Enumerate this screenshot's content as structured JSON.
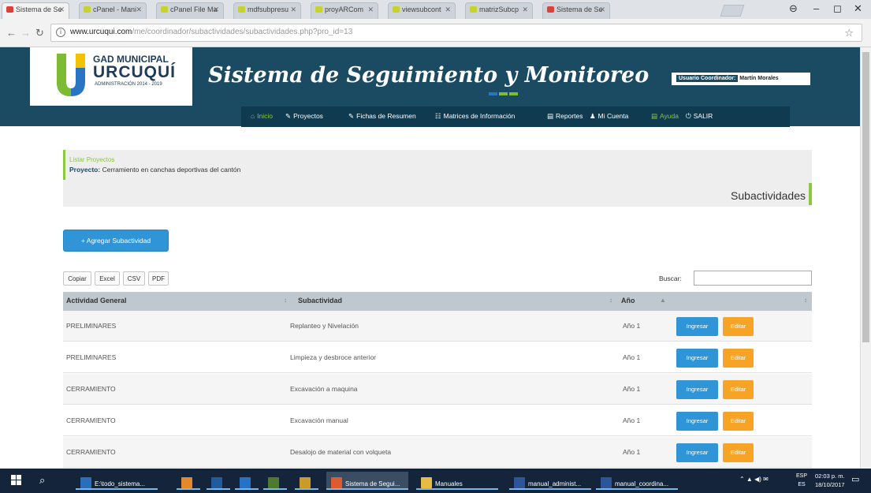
{
  "browser": {
    "tabs": [
      {
        "label": "Sistema de Se",
        "favicon": "red"
      },
      {
        "label": "cPanel - Mani",
        "favicon": "lime"
      },
      {
        "label": "cPanel File Ma",
        "favicon": "lime"
      },
      {
        "label": "mdfsubpresu",
        "favicon": "lime"
      },
      {
        "label": "proyARCom",
        "favicon": "lime"
      },
      {
        "label": "viewsubcont",
        "favicon": "lime"
      },
      {
        "label": "matrizSubcp",
        "favicon": "lime"
      },
      {
        "label": "Sistema de Se",
        "favicon": "red"
      }
    ],
    "url_host": "www.urcuqui.com",
    "url_path": "/me/coordinador/subactividades/subactividades.php?pro_id=13"
  },
  "header": {
    "logo_line1": "GAD MUNICIPAL",
    "logo_line2": "URCUQUÍ",
    "logo_line3": "ADMINISTRACIÓN 2014 - 2019",
    "site_title": "Sistema de Seguimiento y Monitoreo",
    "user_role": "Usuario Coordinador:",
    "user_name": "Martín Morales"
  },
  "menu": [
    {
      "label": "Inicio",
      "icon": "home-icon",
      "glyph": "⌂"
    },
    {
      "label": "Proyectos",
      "icon": "pencil-icon",
      "glyph": "✎"
    },
    {
      "label": "Fichas de Resumen",
      "icon": "pencil-icon",
      "glyph": "✎"
    },
    {
      "label": "Matrices de Información",
      "icon": "grid-icon",
      "glyph": "☷"
    },
    {
      "label": "Reportes",
      "icon": "document-icon",
      "glyph": "▤"
    },
    {
      "label": "Mi Cuenta",
      "icon": "user-icon",
      "glyph": "♟"
    },
    {
      "label": "Ayuda",
      "icon": "document-icon",
      "glyph": "▤"
    },
    {
      "label": "SALIR",
      "icon": "power-icon",
      "glyph": "⏻"
    }
  ],
  "breadcrumb": {
    "link": "Listar Proyectos",
    "project_label": "Proyecto:",
    "project_name": "Cerramiento en canchas deportivas del cantón"
  },
  "page_title": "Subactividades",
  "add_button": "+ Agregar Subactividad",
  "export_buttons": [
    "Copiar",
    "Excel",
    "CSV",
    "PDF"
  ],
  "search_label": "Buscar:",
  "table": {
    "headers": [
      "Actividad General",
      "Subactividad",
      "Año"
    ],
    "rows": [
      {
        "actividad": "PRELIMINARES",
        "subactividad": "Replanteo y Nivelación",
        "anio": "Año 1"
      },
      {
        "actividad": "PRELIMINARES",
        "subactividad": "Limpieza y desbroce anterior",
        "anio": "Año 1"
      },
      {
        "actividad": "CERRAMIENTO",
        "subactividad": "Excavación a maquina",
        "anio": "Año 1"
      },
      {
        "actividad": "CERRAMIENTO",
        "subactividad": "Excavación manual",
        "anio": "Año 1"
      },
      {
        "actividad": "CERRAMIENTO",
        "subactividad": "Desalojo de material con volqueta",
        "anio": "Año 1"
      }
    ],
    "btn_ingresar": "Ingresar",
    "btn_editar": "Editar"
  },
  "taskbar": {
    "items": [
      {
        "label": "E:\\todo_sistema...",
        "color": "#2a6ebb"
      },
      {
        "label": "",
        "color": "#e3892b"
      },
      {
        "label": "",
        "color": "#1f5c9e"
      },
      {
        "label": "",
        "color": "#2672c6"
      },
      {
        "label": "",
        "color": "#4d7a2c"
      },
      {
        "label": "",
        "color": "#c89b2a"
      },
      {
        "label": "Sistema de Segui...",
        "color": "#dc5b31"
      },
      {
        "label": "Manuales",
        "color": "#e8bc42"
      },
      {
        "label": "manual_administ...",
        "color": "#2b579a"
      },
      {
        "label": "manual_coordina...",
        "color": "#2b579a"
      }
    ],
    "lang_top": "ESP",
    "lang_bottom": "ES",
    "time": "02:03 p. m.",
    "date": "18/10/2017"
  },
  "colors": {
    "header_bg": "#1b4b63",
    "accent_green": "#8dc63f",
    "button_blue": "#2f95d6",
    "button_orange": "#f7a325"
  }
}
